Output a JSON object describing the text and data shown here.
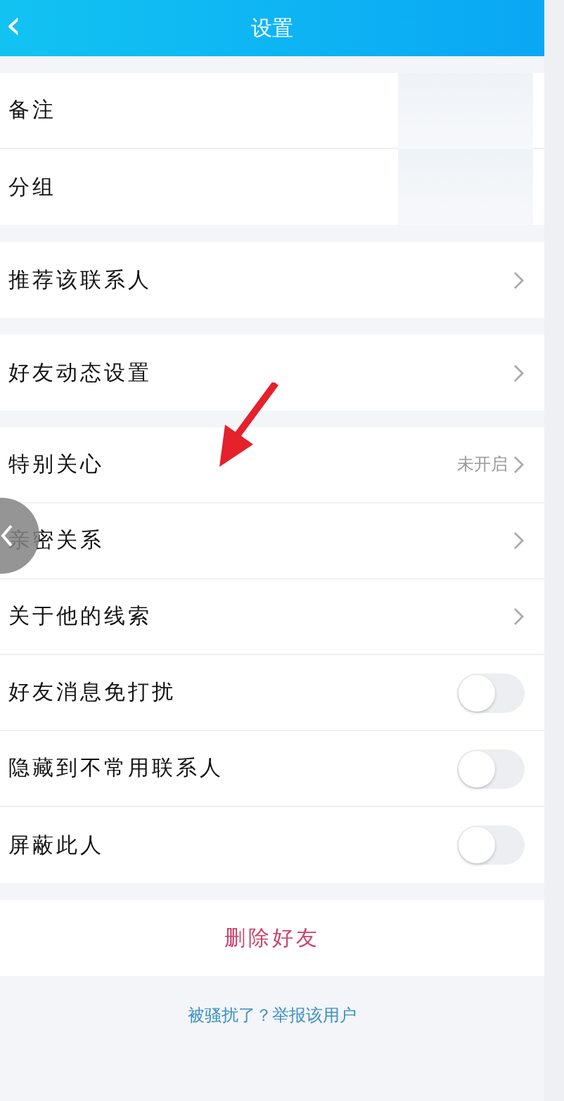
{
  "header": {
    "title": "设置",
    "back": "‹"
  },
  "groups": [
    {
      "rows": [
        {
          "label": "备注",
          "kind": "blurred"
        },
        {
          "label": "分组",
          "kind": "blurred"
        }
      ]
    },
    {
      "rows": [
        {
          "label": "推荐该联系人",
          "kind": "nav"
        }
      ]
    },
    {
      "rows": [
        {
          "label": "好友动态设置",
          "kind": "nav"
        }
      ]
    },
    {
      "rows": [
        {
          "label": "特别关心",
          "kind": "nav",
          "value": "未开启"
        },
        {
          "label": "亲密关系",
          "kind": "nav"
        },
        {
          "label": "关于他的线索",
          "kind": "nav"
        },
        {
          "label": "好友消息免打扰",
          "kind": "toggle",
          "on": false
        },
        {
          "label": "隐藏到不常用联系人",
          "kind": "toggle",
          "on": false
        },
        {
          "label": "屏蔽此人",
          "kind": "toggle",
          "on": false
        }
      ]
    }
  ],
  "delete_button": "删除好友",
  "report_link": "被骚扰了？举报该用户"
}
